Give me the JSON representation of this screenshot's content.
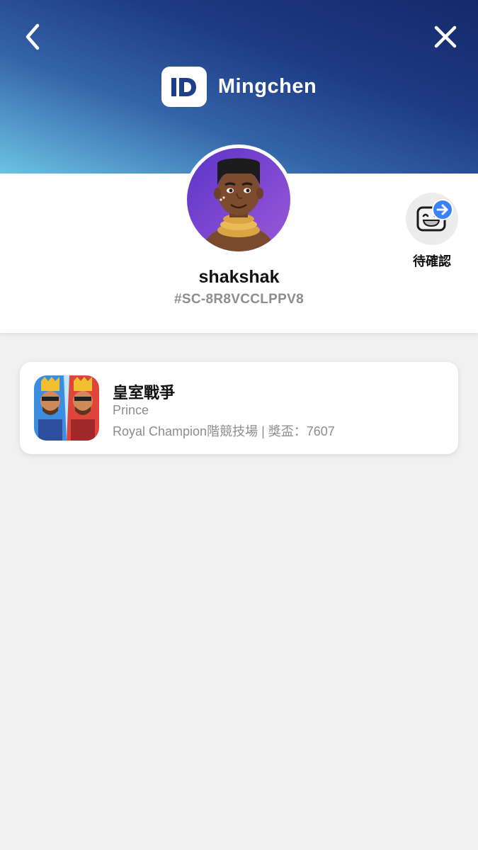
{
  "header": {
    "brand_logo_text": "ID",
    "brand_name": "Mingchen",
    "back_icon": "chevron-left-icon",
    "close_icon": "close-icon",
    "gradient_colors": [
      "#15296a",
      "#1d3a84",
      "#3464a8",
      "#6cc3e4"
    ]
  },
  "profile": {
    "username": "shakshak",
    "user_tag": "#SC-8R8VCCLPPV8",
    "avatar_icon": "avatar-icon"
  },
  "pending": {
    "label": "待確認",
    "icon": "robot-face-icon",
    "badge_icon": "arrow-right-icon",
    "badge_color": "#3b82f6"
  },
  "games": [
    {
      "title": "皇室戰爭",
      "subtitle": "Prince",
      "detail": "Royal Champion階競技場 | 獎盃：7607",
      "icon": "clash-royale-icon"
    }
  ],
  "colors": {
    "background": "#f1f1f1",
    "card": "#ffffff",
    "muted_text": "#8d8d8d"
  }
}
